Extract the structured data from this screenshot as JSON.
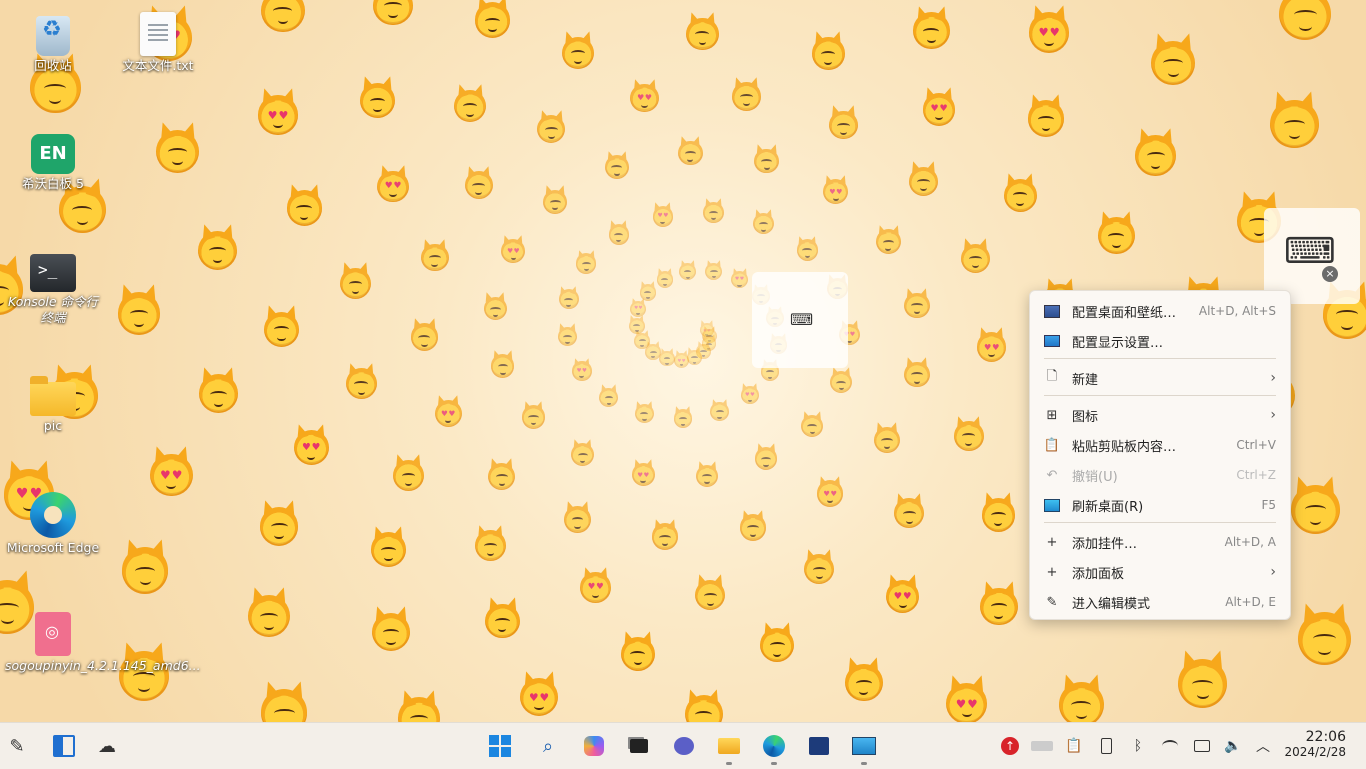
{
  "desktop": {
    "icons": [
      {
        "label": "回收站",
        "icon": "recycle-bin-icon"
      },
      {
        "label": "文本文件.txt",
        "icon": "text-file-icon"
      },
      {
        "label": "希沃白板 5",
        "icon": "en-whiteboard-icon",
        "glyph": "EN"
      },
      {
        "label": "Konsole 命令行终端",
        "icon": "terminal-icon"
      },
      {
        "label": "pic",
        "icon": "folder-icon"
      },
      {
        "label": "Microsoft Edge",
        "icon": "edge-icon"
      },
      {
        "label": "sogoupinyin_4.2.1.145_amd6...",
        "icon": "deb-package-icon"
      }
    ]
  },
  "keyboard_widgets": [
    {
      "icon": "keyboard-icon"
    },
    {
      "icon": "keyboard-icon",
      "close_icon": "close-icon"
    }
  ],
  "context_menu": {
    "items": [
      {
        "label": "配置桌面和壁纸…",
        "shortcut": "Alt+D, Alt+S",
        "icon": "wallpaper-icon"
      },
      {
        "label": "配置显示设置…",
        "shortcut": "",
        "icon": "display-icon"
      },
      {
        "label": "新建",
        "shortcut": "",
        "icon": "new-file-icon",
        "submenu": true
      },
      {
        "label": "图标",
        "shortcut": "",
        "icon": "grid-icon",
        "submenu": true
      },
      {
        "label": "粘贴剪贴板内容…",
        "shortcut": "Ctrl+V",
        "icon": "clipboard-icon"
      },
      {
        "label": "撤销(U)",
        "shortcut": "Ctrl+Z",
        "icon": "undo-icon",
        "disabled": true
      },
      {
        "label": "刷新桌面(R)",
        "shortcut": "F5",
        "icon": "refresh-icon"
      },
      {
        "label": "添加挂件…",
        "shortcut": "Alt+D, A",
        "icon": "plus-icon"
      },
      {
        "label": "添加面板",
        "shortcut": "",
        "icon": "plus-icon",
        "submenu": true
      },
      {
        "label": "进入编辑模式",
        "shortcut": "Alt+D, E",
        "icon": "pencil-icon"
      }
    ],
    "arrow": "›"
  },
  "taskbar": {
    "left": [
      {
        "icon": "pen-icon"
      },
      {
        "icon": "widgets-icon"
      },
      {
        "icon": "cloud-sync-icon"
      }
    ],
    "center": [
      {
        "icon": "start-icon"
      },
      {
        "icon": "search-icon"
      },
      {
        "icon": "copilot-icon"
      },
      {
        "icon": "task-view-icon"
      },
      {
        "icon": "chat-icon"
      },
      {
        "icon": "file-explorer-icon"
      },
      {
        "icon": "edge-icon"
      },
      {
        "icon": "store-icon"
      },
      {
        "icon": "remote-desktop-icon"
      }
    ],
    "tray": [
      {
        "icon": "update-alert-icon"
      },
      {
        "icon": "input-method-icon"
      },
      {
        "icon": "clipboard-icon"
      },
      {
        "icon": "battery-icon"
      },
      {
        "icon": "bluetooth-icon"
      },
      {
        "icon": "wifi-icon"
      },
      {
        "icon": "display-icon"
      },
      {
        "icon": "volume-icon"
      },
      {
        "icon": "chevron-up-icon"
      }
    ],
    "clock": {
      "time": "22:06",
      "date": "2024/2/28"
    }
  },
  "colors": {
    "accent": "#0078d4",
    "menu_bg": "#fbf8f4",
    "taskbar_bg": "#f3efe9"
  }
}
